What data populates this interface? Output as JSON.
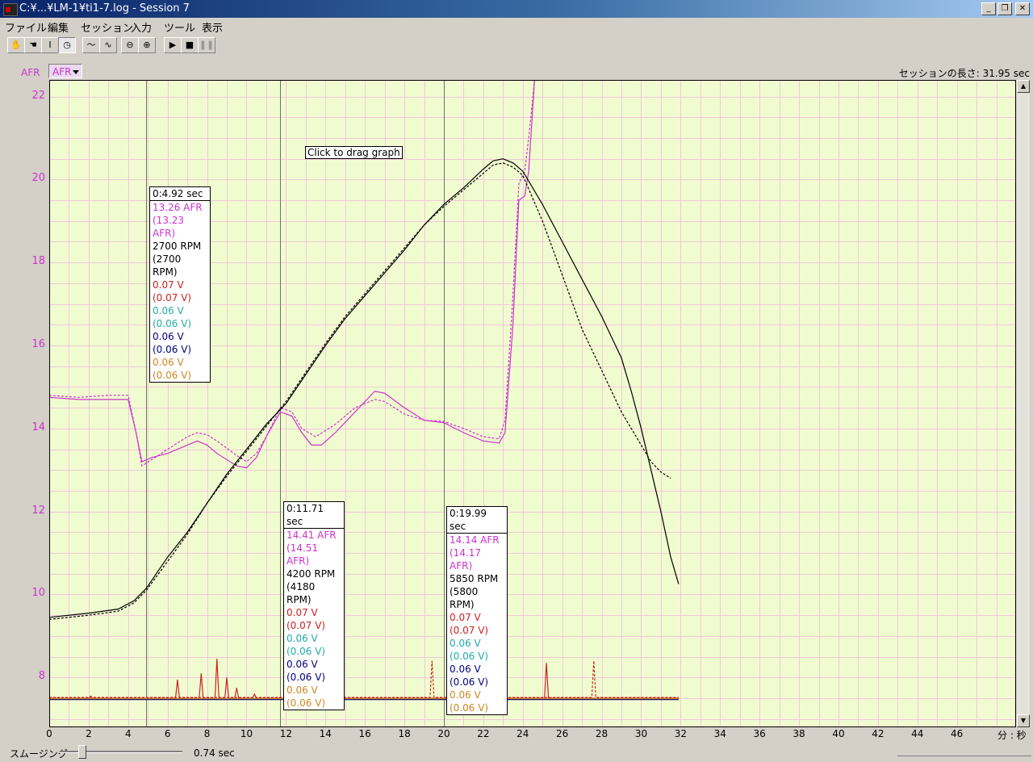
{
  "window": {
    "title": "C:¥...¥LM-1¥ti1-7.log - Session 7",
    "buttons": [
      "_",
      "❐",
      "✕"
    ]
  },
  "menu": [
    "ファイル",
    "編集",
    "セッション",
    "入力",
    "ツール",
    "表示"
  ],
  "toolbar": [
    {
      "icon": "hand-icon",
      "glyph": "✋"
    },
    {
      "icon": "grab-hand-icon",
      "glyph": "☚"
    },
    {
      "icon": "text-cursor-icon",
      "glyph": "I"
    },
    {
      "icon": "clock-icon",
      "glyph": "◷"
    },
    {
      "icon": "smooth-line-icon",
      "glyph": "～"
    },
    {
      "icon": "waveform-icon",
      "glyph": "∿"
    },
    {
      "icon": "zoom-out-icon",
      "glyph": "⊖"
    },
    {
      "icon": "zoom-in-icon",
      "glyph": "⊕"
    },
    {
      "icon": "play-icon",
      "glyph": "▶"
    },
    {
      "icon": "stop-icon",
      "glyph": "■"
    },
    {
      "icon": "pause-icon",
      "glyph": "❚❚"
    }
  ],
  "axis_select": {
    "label": "AFR",
    "value": "AFR"
  },
  "session_length": "セッションの長さ: 31.95 sec",
  "drag_hint": "Click to drag graph",
  "colors": {
    "afr": "#cc33cc",
    "rpm": "#000000",
    "red_v": "#cc2222",
    "teal_v": "#22aaaa",
    "navy_v": "#000080",
    "orange_v": "#cc8822",
    "plot_bg": "#f0fcd0",
    "grid": "#f0c8d8"
  },
  "cursors": [
    {
      "time": 4.92,
      "header": "0:4.92 sec",
      "lines": [
        "13.26 AFR",
        "(13.23 AFR)",
        "2700 RPM",
        "(2700 RPM)",
        "0.07 V",
        "(0.07 V)",
        "0.06 V",
        "(0.06 V)",
        "0.06 V",
        "(0.06 V)",
        "0.06 V",
        "(0.06 V)"
      ]
    },
    {
      "time": 11.71,
      "header": "0:11.71 sec",
      "lines": [
        "14.41 AFR",
        "(14.51 AFR)",
        "4200 RPM",
        "(4180 RPM)",
        "0.07 V",
        "(0.07 V)",
        "0.06 V",
        "(0.06 V)",
        "0.06 V",
        "(0.06 V)",
        "0.06 V",
        "(0.06 V)"
      ]
    },
    {
      "time": 19.99,
      "header": "0:19.99 sec",
      "lines": [
        "14.14 AFR",
        "(14.17 AFR)",
        "5850 RPM",
        "(5800 RPM)",
        "0.07 V",
        "(0.07 V)",
        "0.06 V",
        "(0.06 V)",
        "0.06 V",
        "(0.06 V)",
        "0.06 V",
        "(0.06 V)"
      ]
    }
  ],
  "chart_data": {
    "type": "line",
    "x_ticks": [
      0,
      2,
      4,
      6,
      8,
      10,
      12,
      14,
      16,
      18,
      20,
      22,
      24,
      26,
      28,
      30,
      32,
      34,
      36,
      38,
      40,
      42,
      44,
      46
    ],
    "x_unit": "分 : 秒",
    "xlim": [
      0,
      49
    ],
    "y_ticks": [
      8,
      10,
      12,
      14,
      16,
      18,
      20,
      22
    ],
    "ylim": [
      6.8,
      22.4
    ],
    "grid": true,
    "series": [
      {
        "color": "#cc33cc",
        "dash": false,
        "points": [
          [
            0,
            14.75
          ],
          [
            1.5,
            14.7
          ],
          [
            3,
            14.7
          ],
          [
            4,
            14.7
          ],
          [
            4.4,
            13.9
          ],
          [
            4.7,
            13.2
          ],
          [
            5.2,
            13.3
          ],
          [
            6,
            13.4
          ],
          [
            7,
            13.6
          ],
          [
            7.5,
            13.7
          ],
          [
            8,
            13.6
          ],
          [
            8.5,
            13.4
          ],
          [
            9.5,
            13.1
          ],
          [
            10,
            13.05
          ],
          [
            10.5,
            13.3
          ],
          [
            11,
            13.8
          ],
          [
            11.71,
            14.4
          ],
          [
            12.3,
            14.3
          ],
          [
            12.8,
            13.9
          ],
          [
            13.3,
            13.6
          ],
          [
            13.8,
            13.6
          ],
          [
            14.5,
            13.9
          ],
          [
            15.5,
            14.4
          ],
          [
            16.5,
            14.9
          ],
          [
            17,
            14.85
          ],
          [
            18,
            14.5
          ],
          [
            19,
            14.2
          ],
          [
            19.99,
            14.14
          ],
          [
            21,
            13.9
          ],
          [
            22,
            13.7
          ],
          [
            22.8,
            13.65
          ],
          [
            23.1,
            13.9
          ],
          [
            23.5,
            16.5
          ],
          [
            23.8,
            19.5
          ],
          [
            24.1,
            19.6
          ],
          [
            24.3,
            20.2
          ],
          [
            24.6,
            22.4
          ],
          [
            25,
            22.4
          ],
          [
            31.9,
            22.4
          ]
        ]
      },
      {
        "color": "#cc33cc",
        "dash": true,
        "points": [
          [
            0,
            14.8
          ],
          [
            1.5,
            14.75
          ],
          [
            3,
            14.8
          ],
          [
            4,
            14.8
          ],
          [
            4.4,
            13.9
          ],
          [
            4.7,
            13.1
          ],
          [
            5.2,
            13.25
          ],
          [
            6,
            13.5
          ],
          [
            7,
            13.8
          ],
          [
            7.5,
            13.9
          ],
          [
            8,
            13.85
          ],
          [
            8.5,
            13.7
          ],
          [
            9.5,
            13.35
          ],
          [
            10,
            13.2
          ],
          [
            10.5,
            13.4
          ],
          [
            11,
            13.8
          ],
          [
            11.71,
            14.5
          ],
          [
            12.3,
            14.4
          ],
          [
            12.8,
            14.0
          ],
          [
            13.5,
            13.8
          ],
          [
            14.5,
            14.1
          ],
          [
            15.5,
            14.5
          ],
          [
            16.5,
            14.7
          ],
          [
            17,
            14.65
          ],
          [
            18,
            14.35
          ],
          [
            19,
            14.2
          ],
          [
            19.99,
            14.17
          ],
          [
            21,
            14.0
          ],
          [
            22,
            13.8
          ],
          [
            22.8,
            13.75
          ],
          [
            23.1,
            14.2
          ],
          [
            23.5,
            17.2
          ],
          [
            23.8,
            19.9
          ],
          [
            24.1,
            20.2
          ],
          [
            24.3,
            21.0
          ],
          [
            24.6,
            22.4
          ],
          [
            25,
            22.4
          ],
          [
            31.9,
            22.4
          ]
        ]
      },
      {
        "color": "#000000",
        "dash": false,
        "points": [
          [
            0,
            9.45
          ],
          [
            2,
            9.55
          ],
          [
            3.5,
            9.65
          ],
          [
            4.3,
            9.85
          ],
          [
            4.92,
            10.15
          ],
          [
            6,
            10.9
          ],
          [
            7,
            11.5
          ],
          [
            8,
            12.2
          ],
          [
            9,
            12.9
          ],
          [
            10,
            13.5
          ],
          [
            11,
            14.1
          ],
          [
            12,
            14.6
          ],
          [
            13,
            15.3
          ],
          [
            14,
            16.0
          ],
          [
            15,
            16.65
          ],
          [
            16,
            17.2
          ],
          [
            17,
            17.75
          ],
          [
            18,
            18.3
          ],
          [
            19,
            18.9
          ],
          [
            20,
            19.4
          ],
          [
            21,
            19.8
          ],
          [
            22,
            20.25
          ],
          [
            22.5,
            20.45
          ],
          [
            23,
            20.5
          ],
          [
            23.5,
            20.4
          ],
          [
            24,
            20.2
          ],
          [
            25,
            19.4
          ],
          [
            26,
            18.5
          ],
          [
            27,
            17.6
          ],
          [
            28,
            16.7
          ],
          [
            29,
            15.7
          ],
          [
            29.5,
            14.9
          ],
          [
            30,
            14.0
          ],
          [
            30.5,
            13.0
          ],
          [
            31,
            12.0
          ],
          [
            31.5,
            10.9
          ],
          [
            31.9,
            10.25
          ]
        ]
      },
      {
        "color": "#000000",
        "dash": true,
        "points": [
          [
            0,
            9.4
          ],
          [
            2,
            9.5
          ],
          [
            3.5,
            9.6
          ],
          [
            4.3,
            9.8
          ],
          [
            4.92,
            10.1
          ],
          [
            6,
            10.8
          ],
          [
            7,
            11.45
          ],
          [
            8,
            12.2
          ],
          [
            9,
            12.85
          ],
          [
            10,
            13.45
          ],
          [
            11,
            14.05
          ],
          [
            12,
            14.65
          ],
          [
            13,
            15.35
          ],
          [
            14,
            16.05
          ],
          [
            15,
            16.7
          ],
          [
            16,
            17.25
          ],
          [
            17,
            17.8
          ],
          [
            18,
            18.35
          ],
          [
            19,
            18.9
          ],
          [
            20,
            19.35
          ],
          [
            21,
            19.75
          ],
          [
            22,
            20.15
          ],
          [
            22.5,
            20.35
          ],
          [
            23,
            20.4
          ],
          [
            23.5,
            20.3
          ],
          [
            24,
            20.1
          ],
          [
            25,
            19.0
          ],
          [
            26,
            17.7
          ],
          [
            27,
            16.4
          ],
          [
            28,
            15.4
          ],
          [
            29,
            14.4
          ],
          [
            30,
            13.6
          ],
          [
            30.5,
            13.2
          ],
          [
            31,
            12.95
          ],
          [
            31.5,
            12.8
          ]
        ]
      },
      {
        "color": "#cc2222",
        "dash": false,
        "points": [
          [
            0,
            7.5
          ],
          [
            2,
            7.5
          ],
          [
            2.1,
            7.55
          ],
          [
            2.2,
            7.5
          ],
          [
            6.4,
            7.5
          ],
          [
            6.5,
            7.95
          ],
          [
            6.6,
            7.5
          ],
          [
            7.6,
            7.5
          ],
          [
            7.7,
            8.1
          ],
          [
            7.8,
            7.5
          ],
          [
            8.4,
            7.5
          ],
          [
            8.5,
            8.45
          ],
          [
            8.6,
            7.5
          ],
          [
            8.9,
            7.5
          ],
          [
            9.0,
            8.0
          ],
          [
            9.1,
            7.5
          ],
          [
            9.4,
            7.5
          ],
          [
            9.5,
            7.75
          ],
          [
            9.6,
            7.5
          ],
          [
            10.3,
            7.5
          ],
          [
            10.4,
            7.6
          ],
          [
            10.5,
            7.5
          ],
          [
            13.2,
            7.5
          ],
          [
            13.3,
            8.45
          ],
          [
            13.4,
            7.5
          ],
          [
            25.1,
            7.5
          ],
          [
            25.2,
            8.35
          ],
          [
            25.3,
            7.5
          ],
          [
            31.9,
            7.5
          ]
        ]
      },
      {
        "color": "#cc2222",
        "dash": true,
        "points": [
          [
            0,
            7.52
          ],
          [
            19.3,
            7.52
          ],
          [
            19.4,
            8.4
          ],
          [
            19.5,
            7.52
          ],
          [
            27.5,
            7.52
          ],
          [
            27.6,
            8.4
          ],
          [
            27.7,
            7.52
          ],
          [
            31.9,
            7.52
          ]
        ]
      },
      {
        "color": "#22aaaa",
        "dash": false,
        "points": [
          [
            0,
            7.48
          ],
          [
            31.9,
            7.48
          ]
        ]
      },
      {
        "color": "#000080",
        "dash": false,
        "points": [
          [
            0,
            7.47
          ],
          [
            31.9,
            7.47
          ]
        ]
      },
      {
        "color": "#cc8822",
        "dash": false,
        "points": [
          [
            0,
            7.49
          ],
          [
            31.9,
            7.49
          ]
        ]
      }
    ]
  },
  "smoothing": {
    "label": "スムージング",
    "value": "0.74 sec",
    "level": 0.15
  }
}
